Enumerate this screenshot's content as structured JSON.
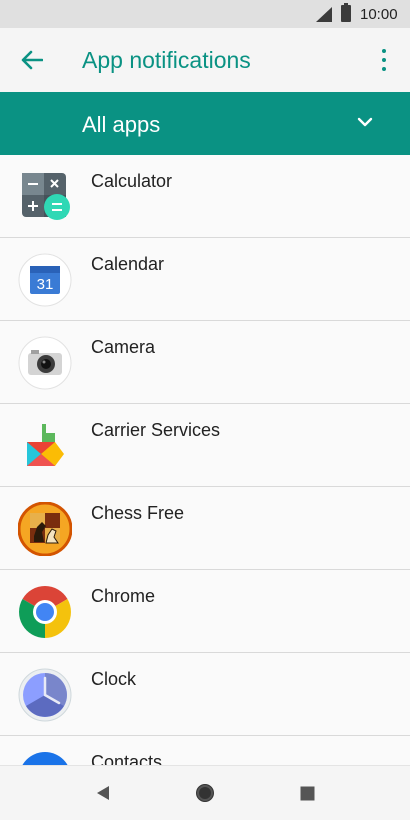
{
  "status_bar": {
    "time": "10:00"
  },
  "toolbar": {
    "title": "App notifications"
  },
  "filter": {
    "selected": "All apps"
  },
  "apps": [
    {
      "name": "Calculator",
      "icon": "calculator-icon"
    },
    {
      "name": "Calendar",
      "icon": "calendar-icon",
      "icon_text": "31"
    },
    {
      "name": "Camera",
      "icon": "camera-icon"
    },
    {
      "name": "Carrier Services",
      "icon": "carrier-services-icon"
    },
    {
      "name": "Chess Free",
      "icon": "chess-icon"
    },
    {
      "name": "Chrome",
      "icon": "chrome-icon"
    },
    {
      "name": "Clock",
      "icon": "clock-icon"
    },
    {
      "name": "Contacts",
      "icon": "contacts-icon"
    }
  ],
  "colors": {
    "accent": "#0a9283",
    "status_bar": "#e0e0e0",
    "list_bg": "#fafafa"
  }
}
